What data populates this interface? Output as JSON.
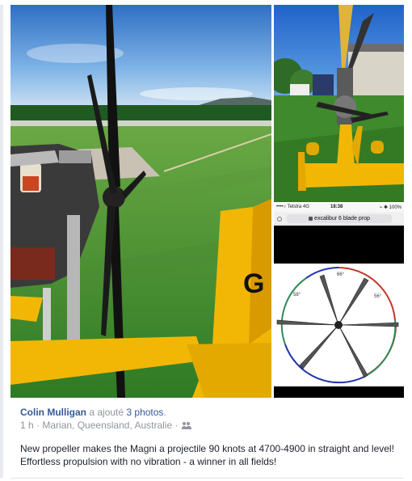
{
  "post": {
    "author": "Colin Mulligan",
    "action_text": "a ajouté",
    "photos_link": "3 photos",
    "period": ".",
    "time": "1 h",
    "separator": "·",
    "location": "Marian, Queensland, Australie",
    "separator2": "·",
    "audience_icon": "friends-icon",
    "text": "New propeller makes the Magni a projectile 90 knots at 4700-4900 in straight and level! Effortless propulsion with no vibration - a winner in all fields!"
  },
  "photos": {
    "main": {
      "subject": "gyrocopter-engine-and-propeller",
      "registration_fragment": "G"
    },
    "top_right": {
      "subject": "gyrocopter-rear-view"
    },
    "bottom_right": {
      "status_bar": {
        "carrier": "••••○ Telstra 4G",
        "time": "18:38",
        "battery": "⌁ ✱ 100%"
      },
      "url_text": "excalibur 6 blade prop",
      "diagram_angles": [
        "66°",
        "58°",
        "56°"
      ]
    }
  },
  "colors": {
    "link_blue": "#365899",
    "meta_grey": "#90949c",
    "text_dark": "#1d2129",
    "aircraft_yellow": "#f2b705",
    "grass_green": "#3f8a2c",
    "sky_blue": "#3a86d6"
  }
}
